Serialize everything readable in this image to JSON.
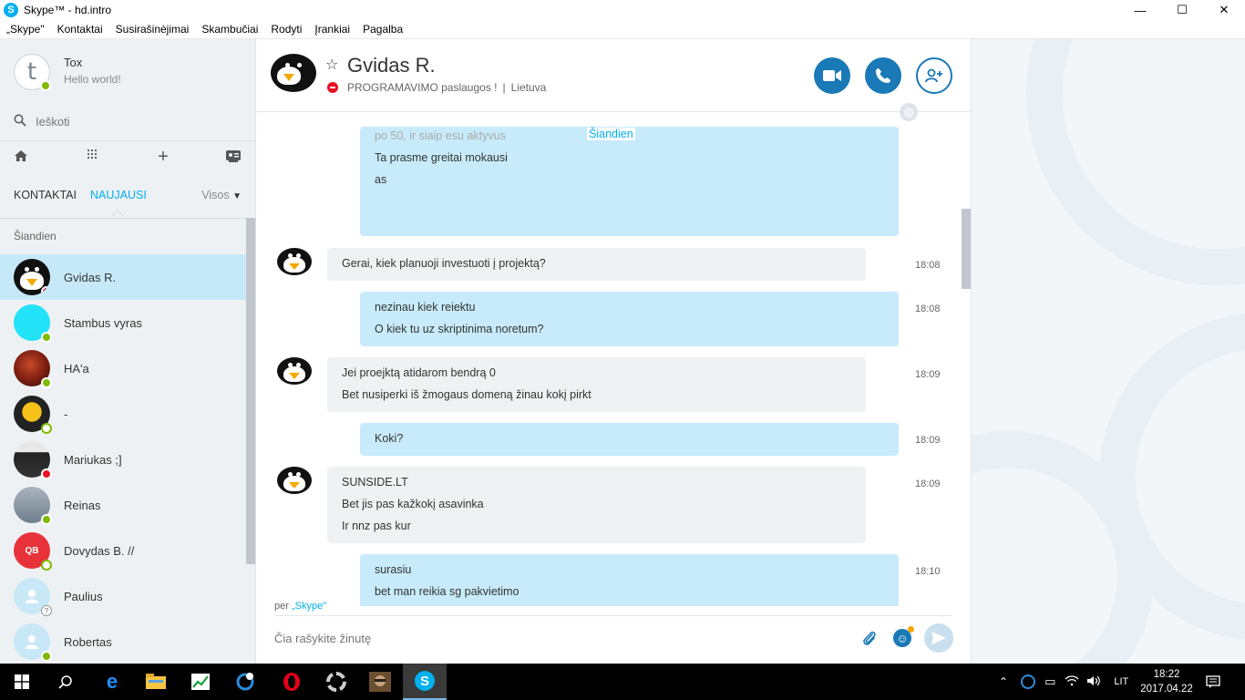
{
  "window": {
    "title": "Skype™ - hd.intro",
    "icon_letter": "S",
    "controls": {
      "minimize": "—",
      "maximize": "☐",
      "close": "✕"
    }
  },
  "menu": [
    "„Skype\"",
    "Kontaktai",
    "Susirašinėjimai",
    "Skambučiai",
    "Rodyti",
    "Įrankiai",
    "Pagalba"
  ],
  "profile": {
    "name": "Tox",
    "mood": "Hello world!",
    "avatar_letter": "t",
    "status": "online"
  },
  "search": {
    "placeholder": "Ieškoti"
  },
  "tabs": {
    "contacts": "KONTAKTAI",
    "recent": "NAUJAUSI",
    "filter": "Visos"
  },
  "section_today": "Šiandien",
  "contacts": [
    {
      "name": "Gvidas R.",
      "status": "busy",
      "avatar": "penguin",
      "selected": true
    },
    {
      "name": "Stambus vyras",
      "status": "online",
      "avatar": "cyan"
    },
    {
      "name": "HA'a",
      "status": "online",
      "avatar": "photo-red"
    },
    {
      "name": "-",
      "status": "away",
      "avatar": "sun"
    },
    {
      "name": "Mariukas ;]",
      "status": "busy",
      "avatar": "photo-mask"
    },
    {
      "name": "Reinas",
      "status": "online",
      "avatar": "photo-man"
    },
    {
      "name": "Dovydas B. //",
      "status": "away",
      "avatar": "red-logo"
    },
    {
      "name": "Paulius",
      "status": "unknown",
      "avatar": "default"
    },
    {
      "name": "Robertas",
      "status": "online",
      "avatar": "default"
    }
  ],
  "chat": {
    "name": "Gvidas R.",
    "mood": "PROGRAMAVIMO paslaugos !",
    "location": "Lietuva",
    "separator": "|",
    "day_label": "Šiandien",
    "messages": [
      {
        "dir": "out",
        "lines": [
          "po 50, ir siaip esu aktyvus",
          "Ta prasme greitai mokausi",
          "as"
        ],
        "time": ""
      },
      {
        "dir": "in",
        "lines": [
          "Gerai, kiek planuoji investuoti į projektą?"
        ],
        "time": "18:08"
      },
      {
        "dir": "out",
        "lines": [
          "nezinau kiek reiektu",
          "O kiek tu uz skriptinima noretum?"
        ],
        "time": "18:08"
      },
      {
        "dir": "in",
        "lines": [
          "Jei proejktą atidarom bendrą 0",
          "Bet nusiperki iš žmogaus domeną žinau kokį pirkt"
        ],
        "time": "18:09"
      },
      {
        "dir": "out",
        "lines": [
          "Koki?"
        ],
        "time": "18:09"
      },
      {
        "dir": "in",
        "lines": [
          "SUNSIDE.LT",
          "Bet jis pas kažkokį asavinka",
          "Ir nnz pas kur"
        ],
        "time": "18:09"
      },
      {
        "dir": "out",
        "lines": [
          "surasiu",
          "bet man reikia sg pakvietimo"
        ],
        "time": "18:10"
      }
    ],
    "via_prefix": "per",
    "via_service": "„Skype\"",
    "compose_placeholder": "Čia rašykite žinutę"
  },
  "taskbar": {
    "tray_lang": "LIT",
    "clock_time": "18:22",
    "clock_date": "2017.04.22"
  },
  "colors": {
    "accent": "#00aff0",
    "button_blue": "#1a79b7",
    "selected_row": "#c6e9f9",
    "out_bubble": "#c7ebfa",
    "in_bubble": "#f0f1f3"
  }
}
